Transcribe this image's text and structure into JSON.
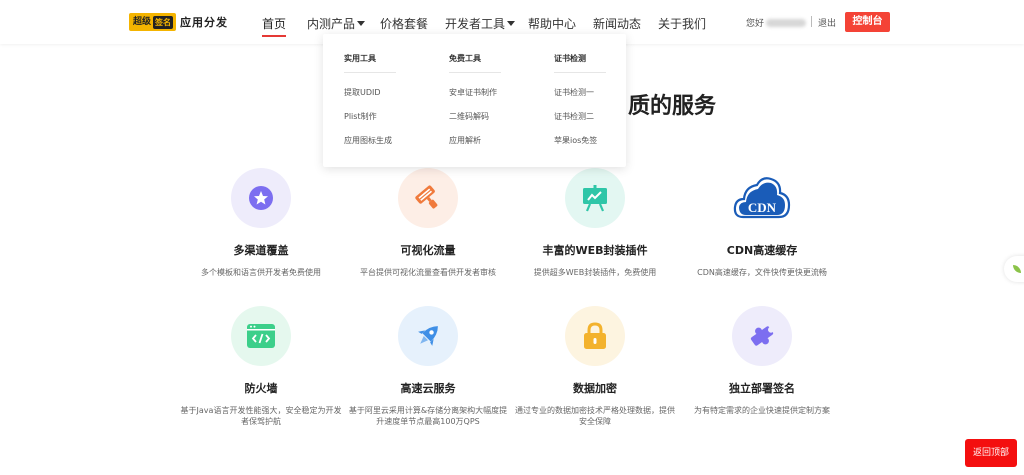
{
  "logo": {
    "badge": "超级",
    "badge_inner": "签名",
    "text": "应用分发"
  },
  "nav": {
    "items": [
      {
        "label": "首页",
        "active": true,
        "caret": false
      },
      {
        "label": "内测产品",
        "active": false,
        "caret": true
      },
      {
        "label": "价格套餐",
        "active": false,
        "caret": false
      },
      {
        "label": "开发者工具",
        "active": false,
        "caret": true
      },
      {
        "label": "帮助中心",
        "active": false,
        "caret": false
      },
      {
        "label": "新闻动态",
        "active": false,
        "caret": false
      },
      {
        "label": "关于我们",
        "active": false,
        "caret": false
      }
    ]
  },
  "user": {
    "greeting": "您好",
    "logout": "退出",
    "console": "控制台"
  },
  "dropdown": {
    "columns": [
      {
        "heading": "实用工具",
        "links": [
          "提取UDID",
          "Plist制作",
          "应用图标生成"
        ]
      },
      {
        "heading": "免费工具",
        "links": [
          "安卓证书制作",
          "二维码解码",
          "应用解析"
        ]
      },
      {
        "heading": "证书检测",
        "links": [
          "证书检测一",
          "证书检测二",
          "苹果ios免签"
        ]
      }
    ]
  },
  "section": {
    "title_visible": "质的服务"
  },
  "features": [
    {
      "title": "多渠道覆盖",
      "desc": "多个模板和语言供开发者免费使用",
      "icon": "star-icon",
      "bg": "#eeecfb",
      "color": "#7c6ef0"
    },
    {
      "title": "可视化流量",
      "desc": "平台提供可视化流量查看供开发者审核",
      "icon": "paint-roller-icon",
      "bg": "#fdeee6",
      "color": "#f07a3c"
    },
    {
      "title": "丰富的WEB封装插件",
      "desc": "提供超多WEB封装插件，免费使用",
      "icon": "presentation-icon",
      "bg": "#e3f7f2",
      "color": "#2fc6a8"
    },
    {
      "title": "CDN高速缓存",
      "desc": "CDN高速缓存，文件快传更快更流畅",
      "icon": "cdn-cloud-icon",
      "bg": "#ffffff",
      "color": "#1a5cb8"
    },
    {
      "title": "防火墙",
      "desc": "基于Java语言开发性能强大，安全稳定为开发者保驾护航",
      "icon": "code-window-icon",
      "bg": "#e5f8ee",
      "color": "#3ccf8a"
    },
    {
      "title": "高速云服务",
      "desc": "基于阿里云采用计算&存储分离架构大幅度提升速度单节点最高100万QPS",
      "icon": "rocket-icon",
      "bg": "#e6f1fc",
      "color": "#3f8fe6"
    },
    {
      "title": "数据加密",
      "desc": "通过专业的数据加密技术严格处理数据，提供安全保障",
      "icon": "lock-icon",
      "bg": "#fdf4e0",
      "color": "#f3b22d"
    },
    {
      "title": "独立部署签名",
      "desc": "为有特定需求的企业快速提供定制方案",
      "icon": "puzzle-icon",
      "bg": "#eeecfb",
      "color": "#7c6ef0"
    }
  ],
  "back_top": "返回顶部"
}
